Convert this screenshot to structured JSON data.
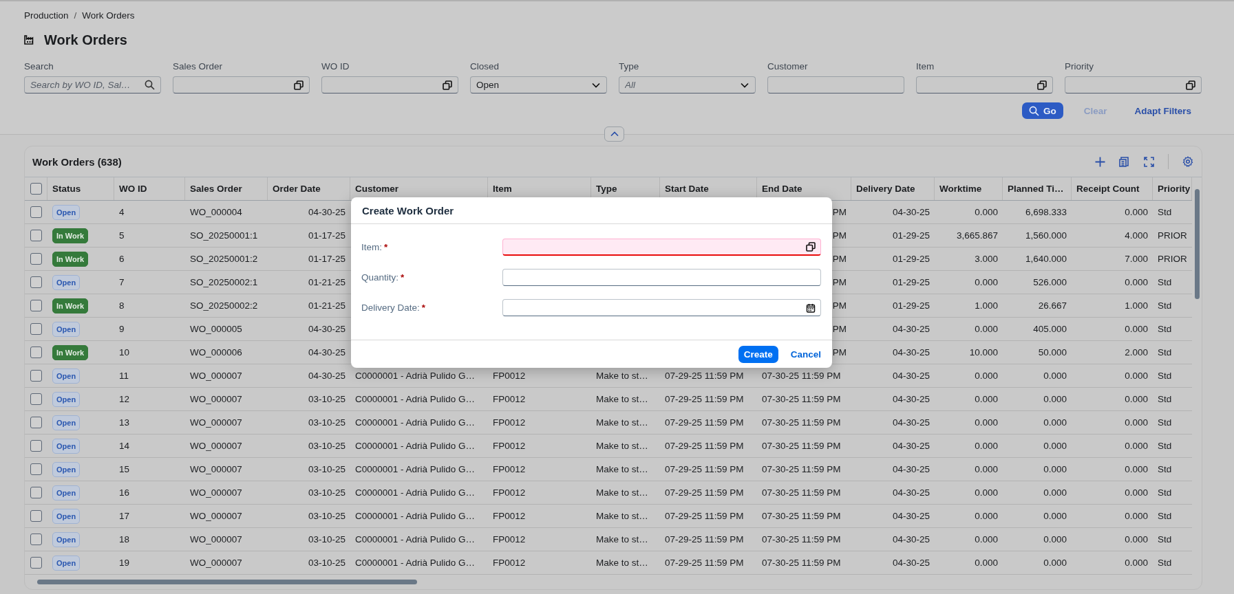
{
  "breadcrumb": [
    "Production",
    "Work Orders"
  ],
  "breadcrumb_separator": "/",
  "page_title": "Work Orders",
  "filters": [
    {
      "label": "Search",
      "kind": "search",
      "placeholder": "Search by WO ID, Sal…"
    },
    {
      "label": "Sales Order",
      "kind": "value-help"
    },
    {
      "label": "WO ID",
      "kind": "value-help"
    },
    {
      "label": "Closed",
      "kind": "select",
      "value": "Open"
    },
    {
      "label": "Type",
      "kind": "select",
      "placeholder": "All"
    },
    {
      "label": "Customer",
      "kind": "text"
    },
    {
      "label": "Item",
      "kind": "value-help"
    },
    {
      "label": "Priority",
      "kind": "value-help"
    }
  ],
  "filter_buttons": [
    {
      "label": "Go",
      "kind": "emphasized",
      "disabled": false
    },
    {
      "label": "Clear",
      "kind": "transparent",
      "disabled": true
    },
    {
      "label": "Adapt Filters",
      "kind": "transparent",
      "disabled": false
    }
  ],
  "table": {
    "title": "Work Orders (638)",
    "header_checked": false,
    "columns": [
      "Status",
      "WO ID",
      "Sales Order",
      "Order Date",
      "Customer",
      "Item",
      "Type",
      "Start Date",
      "End Date",
      "Delivery Date",
      "Worktime",
      "Planned Ti…",
      "Receipt Count",
      "Priority"
    ],
    "rows": [
      {
        "checked": false,
        "status": {
          "label": "Open",
          "kind": "open"
        },
        "wo_id": "4",
        "sales_order": "WO_000004",
        "order_date": "04-30-25",
        "end_date": "PM",
        "delivery_date": "04-30-25",
        "worktime": "0.000",
        "planned_time": "6,698.333",
        "receipt_count": "0.000",
        "priority": "Std"
      },
      {
        "checked": false,
        "status": {
          "label": "In Work",
          "kind": "in-work"
        },
        "wo_id": "5",
        "sales_order": "SO_20250001:1",
        "order_date": "01-17-25",
        "end_date": "PM",
        "delivery_date": "01-29-25",
        "worktime": "3,665.867",
        "planned_time": "1,560.000",
        "receipt_count": "4.000",
        "priority": "PRIOR"
      },
      {
        "checked": false,
        "status": {
          "label": "In Work",
          "kind": "in-work"
        },
        "wo_id": "6",
        "sales_order": "SO_20250001:2",
        "order_date": "01-17-25",
        "end_date": "PM",
        "delivery_date": "01-29-25",
        "worktime": "3.000",
        "planned_time": "1,640.000",
        "receipt_count": "7.000",
        "priority": "PRIOR"
      },
      {
        "checked": false,
        "status": {
          "label": "Open",
          "kind": "open"
        },
        "wo_id": "7",
        "sales_order": "SO_20250002:1",
        "order_date": "01-21-25",
        "end_date": "PM",
        "delivery_date": "01-29-25",
        "worktime": "0.000",
        "planned_time": "526.000",
        "receipt_count": "0.000",
        "priority": "Std"
      },
      {
        "checked": false,
        "status": {
          "label": "In Work",
          "kind": "in-work"
        },
        "wo_id": "8",
        "sales_order": "SO_20250002:2",
        "order_date": "01-21-25",
        "end_date": "PM",
        "delivery_date": "01-29-25",
        "worktime": "1.000",
        "planned_time": "26.667",
        "receipt_count": "1.000",
        "priority": "Std"
      },
      {
        "checked": false,
        "status": {
          "label": "Open",
          "kind": "open"
        },
        "wo_id": "9",
        "sales_order": "WO_000005",
        "order_date": "04-30-25",
        "end_date": "PM",
        "delivery_date": "04-30-25",
        "worktime": "0.000",
        "planned_time": "405.000",
        "receipt_count": "0.000",
        "priority": "Std"
      },
      {
        "checked": false,
        "status": {
          "label": "In Work",
          "kind": "in-work"
        },
        "wo_id": "10",
        "sales_order": "WO_000006",
        "order_date": "04-30-25",
        "end_date": "PM",
        "delivery_date": "04-30-25",
        "worktime": "10.000",
        "planned_time": "50.000",
        "receipt_count": "2.000",
        "priority": "Std"
      },
      {
        "checked": false,
        "status": {
          "label": "Open",
          "kind": "open"
        },
        "wo_id": "11",
        "sales_order": "WO_000007",
        "order_date": "04-30-25",
        "customer": "C0000001 - Adrià Pulido G…",
        "item": "FP0012",
        "type": "Make to st…",
        "start_date": "07-29-25 11:59 PM",
        "end_date": "07-30-25 11:59 PM",
        "delivery_date": "04-30-25",
        "worktime": "0.000",
        "planned_time": "0.000",
        "receipt_count": "0.000",
        "priority": "Std"
      },
      {
        "checked": false,
        "status": {
          "label": "Open",
          "kind": "open"
        },
        "wo_id": "12",
        "sales_order": "WO_000007",
        "order_date": "03-10-25",
        "customer": "C0000001 - Adrià Pulido G…",
        "item": "FP0012",
        "type": "Make to st…",
        "start_date": "07-29-25 11:59 PM",
        "end_date": "07-30-25 11:59 PM",
        "delivery_date": "04-30-25",
        "worktime": "0.000",
        "planned_time": "0.000",
        "receipt_count": "0.000",
        "priority": "Std"
      },
      {
        "checked": false,
        "status": {
          "label": "Open",
          "kind": "open"
        },
        "wo_id": "13",
        "sales_order": "WO_000007",
        "order_date": "03-10-25",
        "customer": "C0000001 - Adrià Pulido G…",
        "item": "FP0012",
        "type": "Make to st…",
        "start_date": "07-29-25 11:59 PM",
        "end_date": "07-30-25 11:59 PM",
        "delivery_date": "04-30-25",
        "worktime": "0.000",
        "planned_time": "0.000",
        "receipt_count": "0.000",
        "priority": "Std"
      },
      {
        "checked": false,
        "status": {
          "label": "Open",
          "kind": "open"
        },
        "wo_id": "14",
        "sales_order": "WO_000007",
        "order_date": "03-10-25",
        "customer": "C0000001 - Adrià Pulido G…",
        "item": "FP0012",
        "type": "Make to st…",
        "start_date": "07-29-25 11:59 PM",
        "end_date": "07-30-25 11:59 PM",
        "delivery_date": "04-30-25",
        "worktime": "0.000",
        "planned_time": "0.000",
        "receipt_count": "0.000",
        "priority": "Std"
      },
      {
        "checked": false,
        "status": {
          "label": "Open",
          "kind": "open"
        },
        "wo_id": "15",
        "sales_order": "WO_000007",
        "order_date": "03-10-25",
        "customer": "C0000001 - Adrià Pulido G…",
        "item": "FP0012",
        "type": "Make to st…",
        "start_date": "07-29-25 11:59 PM",
        "end_date": "07-30-25 11:59 PM",
        "delivery_date": "04-30-25",
        "worktime": "0.000",
        "planned_time": "0.000",
        "receipt_count": "0.000",
        "priority": "Std"
      },
      {
        "checked": false,
        "status": {
          "label": "Open",
          "kind": "open"
        },
        "wo_id": "16",
        "sales_order": "WO_000007",
        "order_date": "03-10-25",
        "customer": "C0000001 - Adrià Pulido G…",
        "item": "FP0012",
        "type": "Make to st…",
        "start_date": "07-29-25 11:59 PM",
        "end_date": "07-30-25 11:59 PM",
        "delivery_date": "04-30-25",
        "worktime": "0.000",
        "planned_time": "0.000",
        "receipt_count": "0.000",
        "priority": "Std"
      },
      {
        "checked": false,
        "status": {
          "label": "Open",
          "kind": "open"
        },
        "wo_id": "17",
        "sales_order": "WO_000007",
        "order_date": "03-10-25",
        "customer": "C0000001 - Adrià Pulido G…",
        "item": "FP0012",
        "type": "Make to st…",
        "start_date": "07-29-25 11:59 PM",
        "end_date": "07-30-25 11:59 PM",
        "delivery_date": "04-30-25",
        "worktime": "0.000",
        "planned_time": "0.000",
        "receipt_count": "0.000",
        "priority": "Std"
      },
      {
        "checked": false,
        "status": {
          "label": "Open",
          "kind": "open"
        },
        "wo_id": "18",
        "sales_order": "WO_000007",
        "order_date": "03-10-25",
        "customer": "C0000001 - Adrià Pulido G…",
        "item": "FP0012",
        "type": "Make to st…",
        "start_date": "07-29-25 11:59 PM",
        "end_date": "07-30-25 11:59 PM",
        "delivery_date": "04-30-25",
        "worktime": "0.000",
        "planned_time": "0.000",
        "receipt_count": "0.000",
        "priority": "Std"
      },
      {
        "checked": false,
        "status": {
          "label": "Open",
          "kind": "open"
        },
        "wo_id": "19",
        "sales_order": "WO_000007",
        "order_date": "03-10-25",
        "customer": "C0000001 - Adrià Pulido G…",
        "item": "FP0012",
        "type": "Make to st…",
        "start_date": "07-29-25 11:59 PM",
        "end_date": "07-30-25 11:59 PM",
        "delivery_date": "04-30-25",
        "worktime": "0.000",
        "planned_time": "0.000",
        "receipt_count": "0.000",
        "priority": "Std"
      }
    ]
  },
  "dialog": {
    "title": "Create Work Order",
    "fields": [
      {
        "label": "Item:",
        "required_mark": "*",
        "error": true,
        "kind": "value-help"
      },
      {
        "label": "Quantity:",
        "required_mark": "*",
        "error": false,
        "kind": "text"
      },
      {
        "label": "Delivery Date:",
        "required_mark": "*",
        "error": false,
        "kind": "date"
      }
    ],
    "buttons": [
      {
        "label": "Create",
        "kind": "emphasized"
      },
      {
        "label": "Cancel",
        "kind": "transparent"
      }
    ]
  }
}
